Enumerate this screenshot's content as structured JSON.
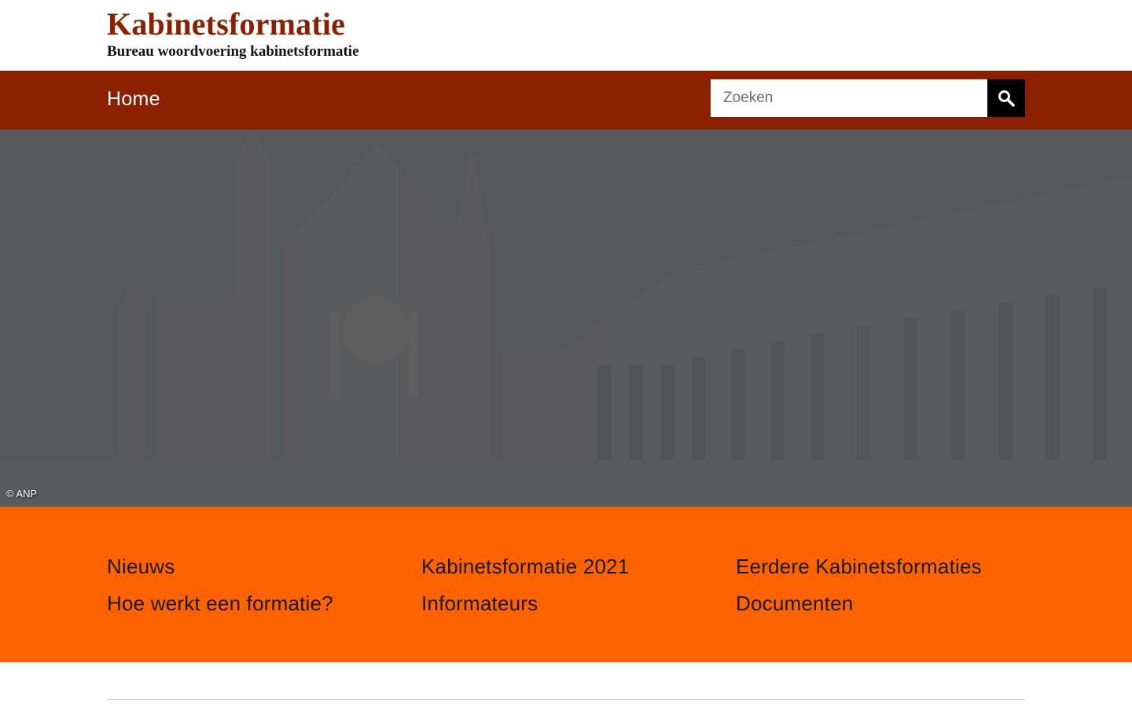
{
  "header": {
    "site_title": "Kabinetsformatie",
    "site_subtitle": "Bureau woordvoering kabinetsformatie"
  },
  "nav": {
    "home_label": "Home",
    "search_placeholder": "Zoeken",
    "search_icon": "search-icon"
  },
  "hero": {
    "credit": "© ANP"
  },
  "quick_links": [
    {
      "label": "Nieuws"
    },
    {
      "label": "Kabinetsformatie 2021"
    },
    {
      "label": "Eerdere Kabinetsformaties"
    },
    {
      "label": "Hoe werkt een formatie?"
    },
    {
      "label": "Informateurs"
    },
    {
      "label": "Documenten"
    }
  ],
  "colors": {
    "brand_dark_red": "#8b2000",
    "accent_orange": "#ff6200",
    "hero_overlay": "#55585b",
    "search_button": "#000000"
  }
}
